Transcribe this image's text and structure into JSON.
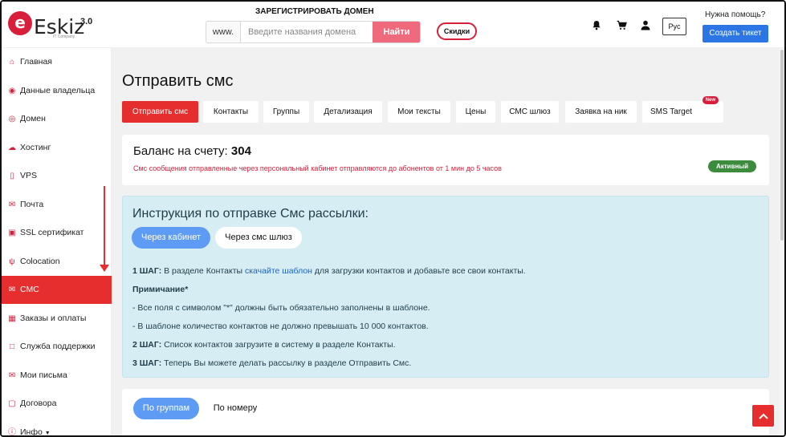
{
  "header": {
    "logo_letter": "e",
    "logo_text": "Eskiz",
    "logo_version": "3.0",
    "logo_subtitle": "IT Company",
    "register_title": "ЗАРЕГИСТРИРОВАТЬ ДОМЕН",
    "domain_prefix": "www.",
    "domain_placeholder": "Введите названия домена",
    "find_button": "Найти",
    "discount_button": "Скидки",
    "language": "Рус",
    "help_text": "Нужна помощь?",
    "ticket_button": "Создать тикет",
    "icons": [
      "bell-icon",
      "cart-icon",
      "user-icon"
    ]
  },
  "sidebar": {
    "items": [
      {
        "label": "Главная",
        "icon": "home-icon"
      },
      {
        "label": "Данные владельца",
        "icon": "owner-icon"
      },
      {
        "label": "Домен",
        "icon": "globe-icon"
      },
      {
        "label": "Хостинг",
        "icon": "cloud-icon"
      },
      {
        "label": "VPS",
        "icon": "server-icon"
      },
      {
        "label": "Почта",
        "icon": "mail-icon"
      },
      {
        "label": "SSL сертификат",
        "icon": "lock-icon"
      },
      {
        "label": "Colocation",
        "icon": "colocation-icon"
      },
      {
        "label": "СМС",
        "icon": "sms-icon",
        "active": true
      },
      {
        "label": "Заказы и оплаты",
        "icon": "calculator-icon"
      },
      {
        "label": "Служба поддержки",
        "icon": "support-icon"
      },
      {
        "label": "Мои письма",
        "icon": "letters-icon"
      },
      {
        "label": "Договора",
        "icon": "contract-icon"
      },
      {
        "label": "Инфо",
        "icon": "info-icon"
      }
    ]
  },
  "main": {
    "title": "Отправить смс",
    "tabs": [
      {
        "label": "Отправить смс",
        "active": true
      },
      {
        "label": "Контакты"
      },
      {
        "label": "Группы"
      },
      {
        "label": "Детализация"
      },
      {
        "label": "Мои тексты"
      },
      {
        "label": "Цены"
      },
      {
        "label": "СМС шлюз"
      },
      {
        "label": "Заявка на ник"
      },
      {
        "label": "SMS Target",
        "badge": "New"
      }
    ],
    "balance": {
      "label": "Баланс на счету:",
      "value": "304",
      "note": "Смс сообщения отправленные через персональный кабинет отправляются до абонентов от 1 мин до 5 часов",
      "status": "Активный"
    },
    "instructions": {
      "title": "Инструкция по отправке Смс рассылки:",
      "pill_cabinet": "Через кабинет",
      "pill_gateway": "Через смс шлюз",
      "step1_head": "1 ШАГ:",
      "step1_pre": "В разделе Контакты",
      "step1_link": "скачайте шаблон",
      "step1_post": "для загрузки контактов и добавьте все свои контакты.",
      "note_head": "Примичание*",
      "note1": "- Все поля с символом \"*\" должны быть обязательно заполнены в шаблоне.",
      "note2": "- В шаблоне количество контактов не должно превышать 10 000 контактов.",
      "step2_head": "2 ШАГ:",
      "step2_text": "Список контактов загрузите в систему в разделе Контакты.",
      "step3_head": "3 ШАГ:",
      "step3_text": "Теперь Вы можете делать рассылку в разделе Отправить Смс."
    },
    "group_toggle": {
      "by_groups": "По группам",
      "by_number": "По номеру"
    }
  },
  "colors": {
    "brand_red": "#e52e2d",
    "ticket_blue": "#2b76e4",
    "status_green": "#3d8b3d",
    "info_bg": "#d6edf3"
  }
}
